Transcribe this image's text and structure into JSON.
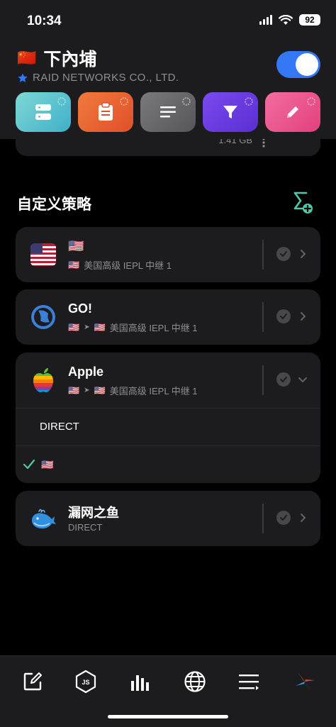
{
  "status_bar": {
    "time": "10:34",
    "battery": "92"
  },
  "header": {
    "flag": "🇨🇳",
    "title": "下內埔",
    "subtitle": "RAID NETWORKS CO., LTD.",
    "enabled": true
  },
  "tiles": [
    {
      "icon": "server-icon",
      "color": "#5ec9c9"
    },
    {
      "icon": "clipboard-icon",
      "color": "#e8602c"
    },
    {
      "icon": "list-icon",
      "color": "#636366"
    },
    {
      "icon": "filter-icon",
      "color": "#6b3fe0"
    },
    {
      "icon": "pencil-icon",
      "color": "#ec4f8e"
    }
  ],
  "partial_card": {
    "text": "1.41 GB"
  },
  "section": {
    "title": "自定义策略"
  },
  "policies": [
    {
      "icon": "us-flag-icon",
      "name": "🇺🇸",
      "sub_from": "",
      "sub_to": "🇺🇸",
      "sub_label": "美国高级 IEPL 中继 1"
    },
    {
      "icon": "globe-icon",
      "name": "GO!",
      "sub_from": "🇺🇸",
      "sub_arrow": "➤",
      "sub_to": "🇺🇸",
      "sub_label": "美国高级 IEPL 中继 1"
    },
    {
      "icon": "apple-icon",
      "name": "Apple",
      "sub_from": "🇺🇸",
      "sub_arrow": "➤",
      "sub_to": "🇺🇸",
      "sub_label": "美国高级 IEPL 中继 1",
      "expanded": true,
      "options": [
        {
          "label": "DIRECT",
          "selected": false
        },
        {
          "label": "🇺🇸",
          "selected": true
        }
      ]
    },
    {
      "icon": "whale-icon",
      "name": "漏网之鱼",
      "sub_label": "DIRECT"
    }
  ],
  "tab_bar": [
    {
      "icon": "edit-icon"
    },
    {
      "icon": "js-icon",
      "label": "JS"
    },
    {
      "icon": "chart-icon"
    },
    {
      "icon": "globe-icon"
    },
    {
      "icon": "list-icon"
    },
    {
      "icon": "pinwheel-icon"
    }
  ],
  "colors": {
    "accent": "#3478f6",
    "card": "#1c1c1e",
    "teal": "#4fc9a8"
  }
}
